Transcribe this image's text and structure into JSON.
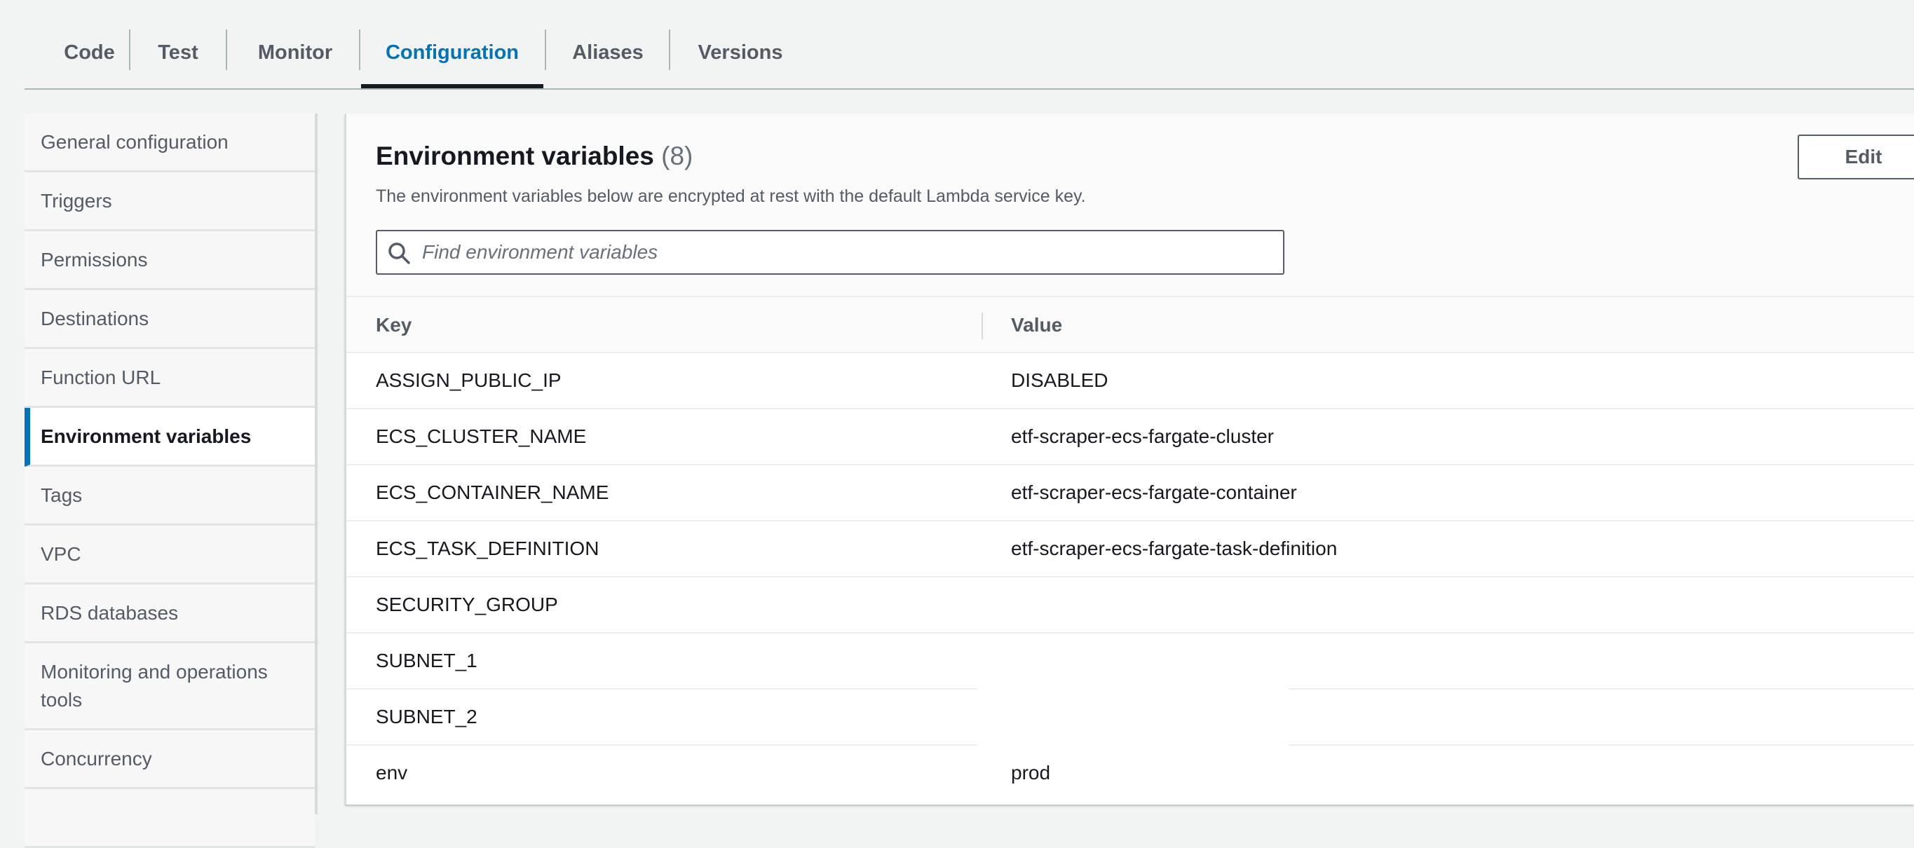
{
  "tabs": [
    {
      "label": "Code",
      "active": false
    },
    {
      "label": "Test",
      "active": false
    },
    {
      "label": "Monitor",
      "active": false
    },
    {
      "label": "Configuration",
      "active": true
    },
    {
      "label": "Aliases",
      "active": false
    },
    {
      "label": "Versions",
      "active": false
    }
  ],
  "sidenav": {
    "items": [
      {
        "label": "General configuration"
      },
      {
        "label": "Triggers"
      },
      {
        "label": "Permissions"
      },
      {
        "label": "Destinations"
      },
      {
        "label": "Function URL"
      },
      {
        "label": "Environment variables",
        "active": true
      },
      {
        "label": "Tags"
      },
      {
        "label": "VPC"
      },
      {
        "label": "RDS databases"
      },
      {
        "label": "Monitoring and operations tools"
      },
      {
        "label": "Concurrency"
      }
    ]
  },
  "panel": {
    "title": "Environment variables",
    "count": "(8)",
    "description": "The environment variables below are encrypted at rest with the default Lambda service key.",
    "edit_label": "Edit",
    "search_placeholder": "Find environment variables"
  },
  "table": {
    "headers": {
      "key": "Key",
      "value": "Value"
    },
    "rows": [
      {
        "key": "ASSIGN_PUBLIC_IP",
        "value": "DISABLED"
      },
      {
        "key": "ECS_CLUSTER_NAME",
        "value": "etf-scraper-ecs-fargate-cluster"
      },
      {
        "key": "ECS_CONTAINER_NAME",
        "value": "etf-scraper-ecs-fargate-container"
      },
      {
        "key": "ECS_TASK_DEFINITION",
        "value": "etf-scraper-ecs-fargate-task-definition"
      },
      {
        "key": "SECURITY_GROUP",
        "value": ""
      },
      {
        "key": "SUBNET_1",
        "value": ""
      },
      {
        "key": "SUBNET_2",
        "value": ""
      },
      {
        "key": "env",
        "value": "prod"
      }
    ]
  },
  "colors": {
    "accent": "#0073bb",
    "text": "#16191f",
    "muted": "#545b64",
    "background": "#f2f3f3"
  }
}
